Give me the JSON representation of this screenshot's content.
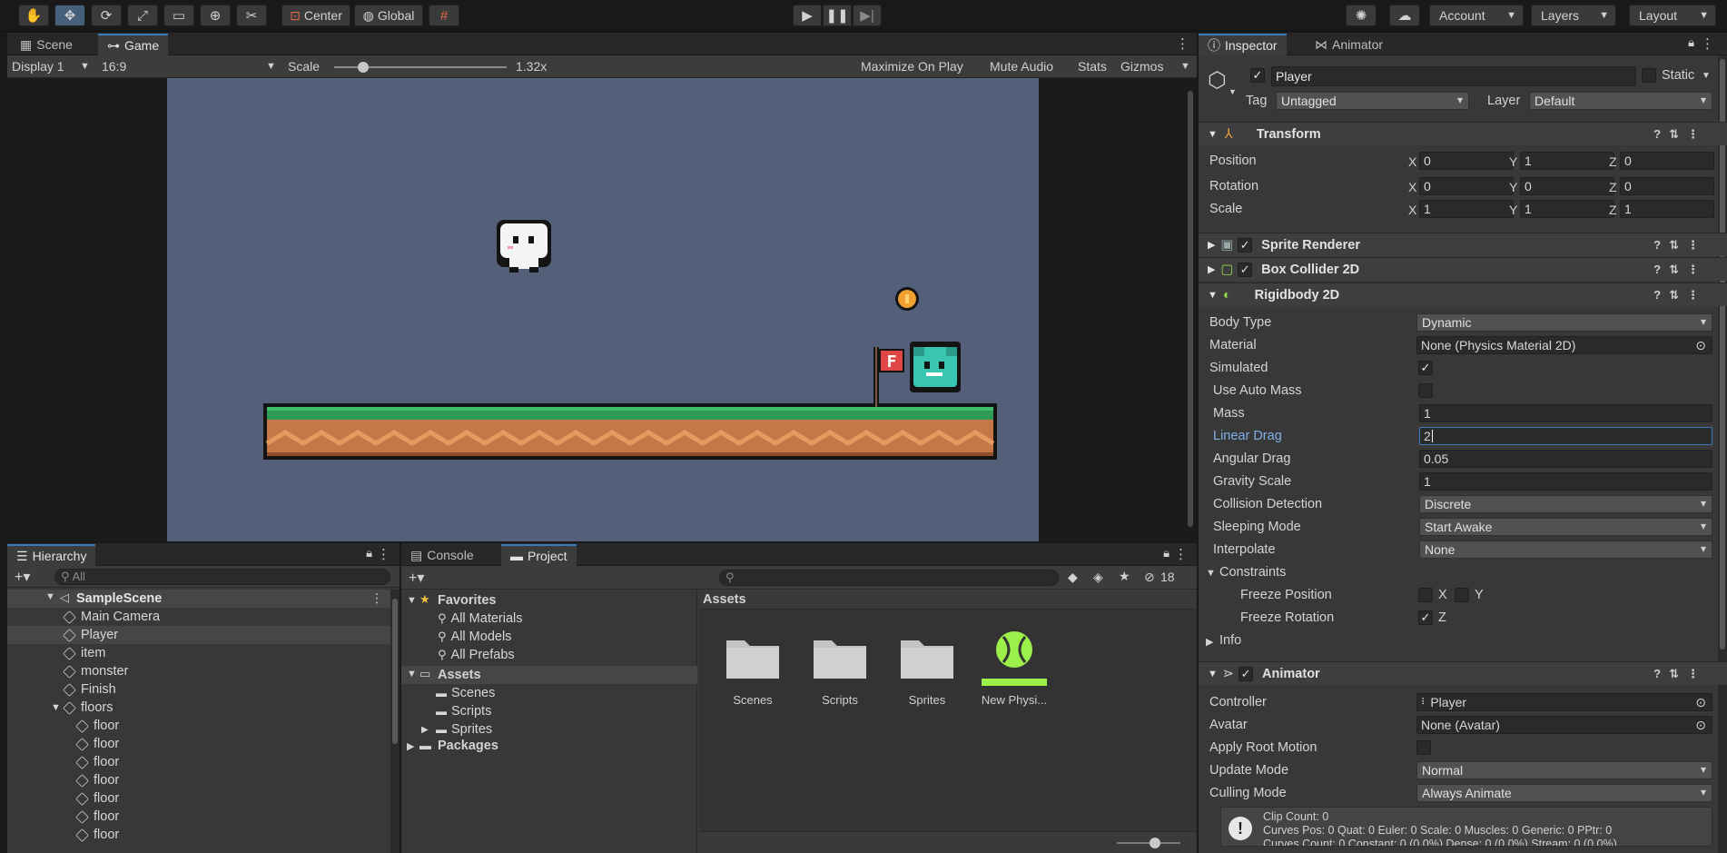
{
  "toolbar": {
    "tools": [
      "hand-tool",
      "move-tool",
      "rotate-tool",
      "scale-tool",
      "rect-tool",
      "transform-tool",
      "custom-tool"
    ],
    "pivot": "Center",
    "space": "Global",
    "account": "Account",
    "layers": "Layers",
    "layout": "Layout"
  },
  "scene_tabs": {
    "scene": "Scene",
    "game": "Game"
  },
  "game_bar": {
    "display": "Display 1",
    "aspect": "16:9",
    "scale_label": "Scale",
    "scale_value": "1.32x",
    "scale_fraction": 0.17,
    "maximize": "Maximize On Play",
    "mute": "Mute Audio",
    "stats": "Stats",
    "gizmos": "Gizmos"
  },
  "game_view": {
    "flag_letter": "F",
    "bg_color": "#545f7a"
  },
  "hierarchy": {
    "tab": "Hierarchy",
    "search_placeholder": "All",
    "scene": "SampleScene",
    "items": [
      {
        "label": "Main Camera",
        "depth": 1
      },
      {
        "label": "Player",
        "depth": 1,
        "selected": true
      },
      {
        "label": "item",
        "depth": 1
      },
      {
        "label": "monster",
        "depth": 1
      },
      {
        "label": "Finish",
        "depth": 1
      },
      {
        "label": "floors",
        "depth": 1,
        "expanded": true
      },
      {
        "label": "floor",
        "depth": 2
      },
      {
        "label": "floor",
        "depth": 2
      },
      {
        "label": "floor",
        "depth": 2
      },
      {
        "label": "floor",
        "depth": 2
      },
      {
        "label": "floor",
        "depth": 2
      },
      {
        "label": "floor",
        "depth": 2
      },
      {
        "label": "floor",
        "depth": 2
      }
    ]
  },
  "project": {
    "tabs": {
      "console": "Console",
      "project": "Project"
    },
    "hidden_count": "18",
    "favorites": {
      "title": "Favorites",
      "items": [
        "All Materials",
        "All Models",
        "All Prefabs"
      ]
    },
    "assets_tree": {
      "title": "Assets",
      "items": [
        "Scenes",
        "Scripts",
        "Sprites"
      ]
    },
    "packages": "Packages",
    "assets_header": "Assets",
    "assets": [
      {
        "label": "Scenes",
        "kind": "folder"
      },
      {
        "label": "Scripts",
        "kind": "folder"
      },
      {
        "label": "Sprites",
        "kind": "folder"
      },
      {
        "label": "New Physi...",
        "kind": "physics-material"
      }
    ]
  },
  "inspector": {
    "tabs": {
      "inspector": "Inspector",
      "animator": "Animator"
    },
    "object_name": "Player",
    "static": "Static",
    "tag_label": "Tag",
    "tag_value": "Untagged",
    "layer_label": "Layer",
    "layer_value": "Default",
    "transform": {
      "title": "Transform",
      "position_label": "Position",
      "position": [
        "0",
        "1",
        "0"
      ],
      "rotation_label": "Rotation",
      "rotation": [
        "0",
        "0",
        "0"
      ],
      "scale_label": "Scale",
      "scale": [
        "1",
        "1",
        "1"
      ]
    },
    "sprite_renderer": "Sprite Renderer",
    "box_collider": "Box Collider 2D",
    "rigidbody": {
      "title": "Rigidbody 2D",
      "body_type_label": "Body Type",
      "body_type": "Dynamic",
      "material_label": "Material",
      "material": "None (Physics Material 2D)",
      "simulated_label": "Simulated",
      "auto_mass_label": "Use Auto Mass",
      "mass_label": "Mass",
      "mass": "1",
      "linear_drag_label": "Linear Drag",
      "linear_drag": "2",
      "angular_drag_label": "Angular Drag",
      "angular_drag": "0.05",
      "gravity_label": "Gravity Scale",
      "gravity": "1",
      "collision_label": "Collision Detection",
      "collision": "Discrete",
      "sleeping_label": "Sleeping Mode",
      "sleeping": "Start Awake",
      "interpolate_label": "Interpolate",
      "interpolate": "None",
      "constraints_label": "Constraints",
      "freeze_pos_label": "Freeze Position",
      "freeze_rot_label": "Freeze Rotation",
      "x": "X",
      "y": "Y",
      "z": "Z",
      "info_label": "Info"
    },
    "animator": {
      "title": "Animator",
      "controller_label": "Controller",
      "controller": "Player",
      "avatar_label": "Avatar",
      "avatar": "None (Avatar)",
      "root_motion_label": "Apply Root Motion",
      "update_label": "Update Mode",
      "update": "Normal",
      "culling_label": "Culling Mode",
      "culling": "Always Animate",
      "info_lines": [
        "Clip Count: 0",
        "Curves Pos: 0 Quat: 0 Euler: 0 Scale: 0 Muscles: 0 Generic: 0 PPtr: 0",
        "Curves Count: 0 Constant: 0 (0.0%) Dense: 0 (0.0%) Stream: 0 (0.0%)"
      ]
    }
  }
}
